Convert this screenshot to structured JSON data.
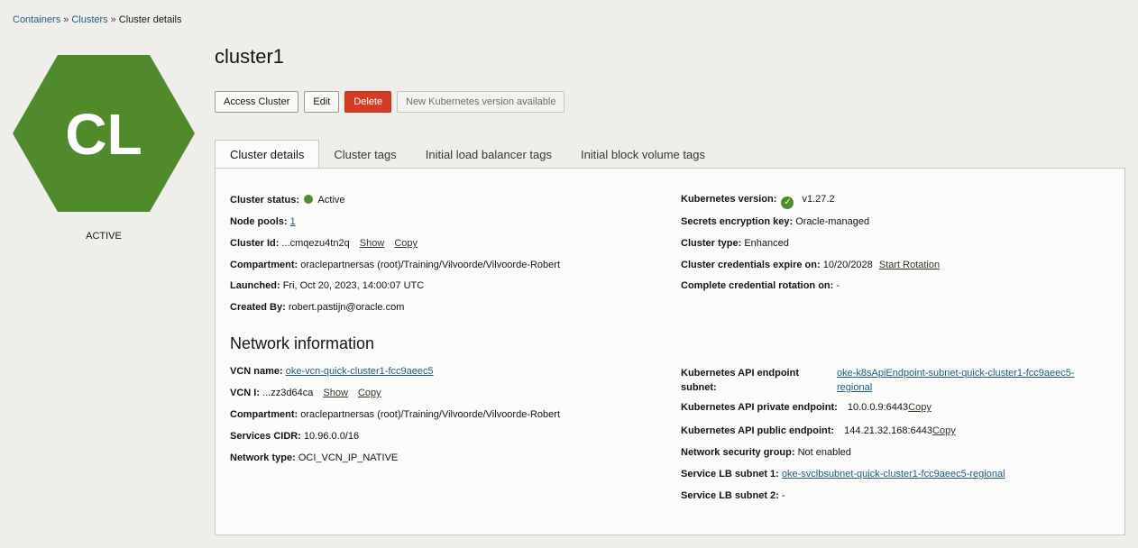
{
  "breadcrumb": {
    "items": [
      "Containers",
      "Clusters"
    ],
    "current": "Cluster details",
    "sep": "»"
  },
  "avatar": {
    "initials": "CL",
    "status": "ACTIVE",
    "color": "#4f8a2b"
  },
  "title": "cluster1",
  "actions": {
    "access": "Access Cluster",
    "edit": "Edit",
    "delete": "Delete",
    "upgrade": "New Kubernetes version available"
  },
  "tabs": [
    "Cluster details",
    "Cluster tags",
    "Initial load balancer tags",
    "Initial block volume tags"
  ],
  "details": {
    "status_label": "Cluster status:",
    "status_value": "Active",
    "nodepools_label": "Node pools:",
    "nodepools_value": "1",
    "clusterid_label": "Cluster Id:",
    "clusterid_value": "...cmqezu4tn2q",
    "show": "Show",
    "copy": "Copy",
    "compartment_label": "Compartment:",
    "compartment_value": "oraclepartnersas (root)/Training/Vilvoorde/Vilvoorde-Robert",
    "launched_label": "Launched:",
    "launched_value": "Fri, Oct 20, 2023, 14:00:07 UTC",
    "createdby_label": "Created By:",
    "createdby_value": "robert.pastijn@oracle.com",
    "k8s_label": "Kubernetes version:",
    "k8s_value": "v1.27.2",
    "secrets_label": "Secrets encryption key:",
    "secrets_value": "Oracle-managed",
    "type_label": "Cluster type:",
    "type_value": "Enhanced",
    "creds_label": "Cluster credentials expire on:",
    "creds_value": "10/20/2028",
    "start_rotation": "Start Rotation",
    "rotation_label": "Complete credential rotation on:",
    "rotation_value": "-"
  },
  "network": {
    "heading": "Network information",
    "vcn_label": "VCN name:",
    "vcn_value": "oke-vcn-quick-cluster1-fcc9aeec5",
    "vcnid_label": "VCN I:",
    "vcnid_value": "...zz3d64ca",
    "show": "Show",
    "copy": "Copy",
    "compartment_label": "Compartment:",
    "compartment_value": "oraclepartnersas (root)/Training/Vilvoorde/Vilvoorde-Robert",
    "cidr_label": "Services CIDR:",
    "cidr_value": "10.96.0.0/16",
    "nettype_label": "Network type:",
    "nettype_value": "OCI_VCN_IP_NATIVE",
    "api_subnet_label1": "Kubernetes API endpoint",
    "api_subnet_label2": "subnet:",
    "api_subnet_value1": "oke-k8sApiEndpoint-subnet-quick-cluster1-fcc9aeec5-",
    "api_subnet_value2": "regional",
    "private_label": "Kubernetes API private endpoint:",
    "private_value": "10.0.0.9:6443",
    "public_label": "Kubernetes API public endpoint:",
    "public_value": "144.21.32.168:6443",
    "nsg_label": "Network security group:",
    "nsg_value": "Not enabled",
    "lb1_label": "Service LB subnet 1:",
    "lb1_value": "oke-svclbsubnet-quick-cluster1-fcc9aeec5-regional",
    "lb2_label": "Service LB subnet 2:",
    "lb2_value": "-"
  }
}
